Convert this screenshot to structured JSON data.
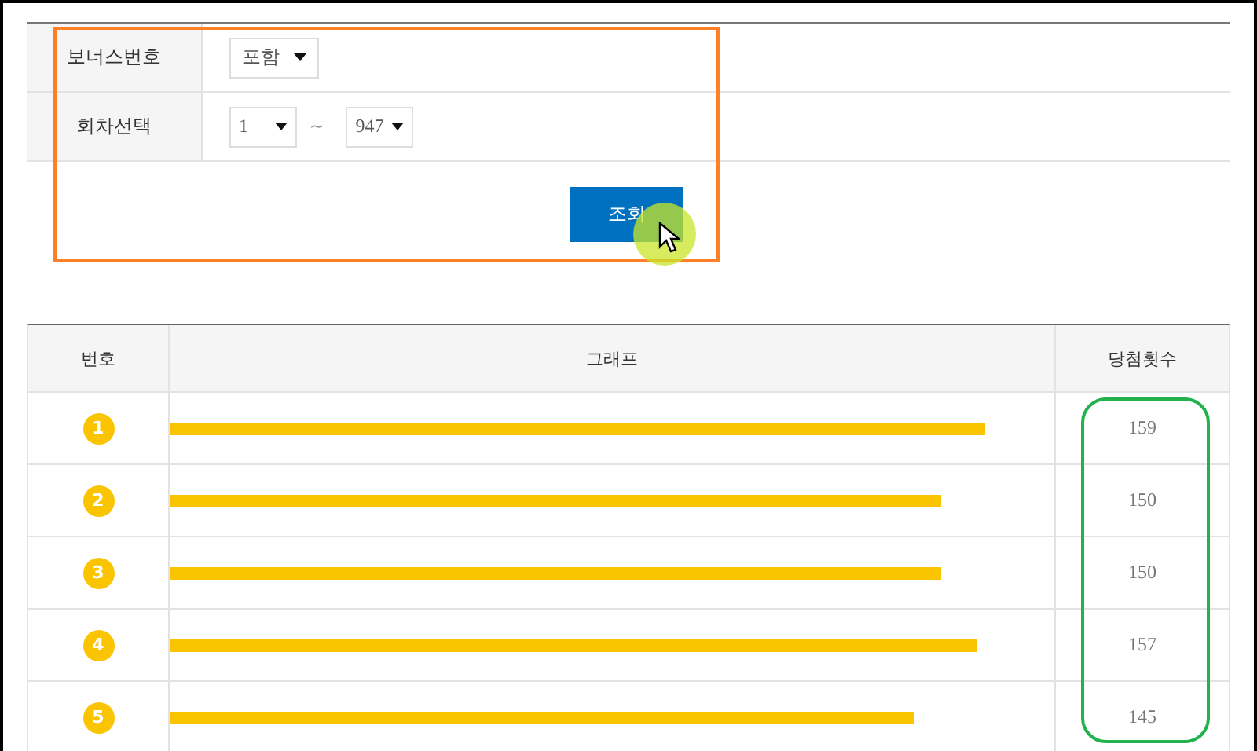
{
  "filter": {
    "rows": [
      {
        "label": "보너스번호",
        "kind": "single",
        "select": "포함"
      },
      {
        "label": "회차선택",
        "kind": "range",
        "from": "1",
        "separator": "~",
        "to": "947"
      }
    ],
    "button": "조회"
  },
  "table": {
    "columns": [
      "번호",
      "그래프",
      "당첨횟수"
    ],
    "rows": [
      {
        "number": "1",
        "level": 0.922,
        "count": "159"
      },
      {
        "number": "2",
        "level": 0.872,
        "count": "150"
      },
      {
        "number": "3",
        "level": 0.872,
        "count": "150"
      },
      {
        "number": "4",
        "level": 0.913,
        "count": "157"
      },
      {
        "number": "5",
        "level": 0.842,
        "count": "145"
      }
    ]
  }
}
